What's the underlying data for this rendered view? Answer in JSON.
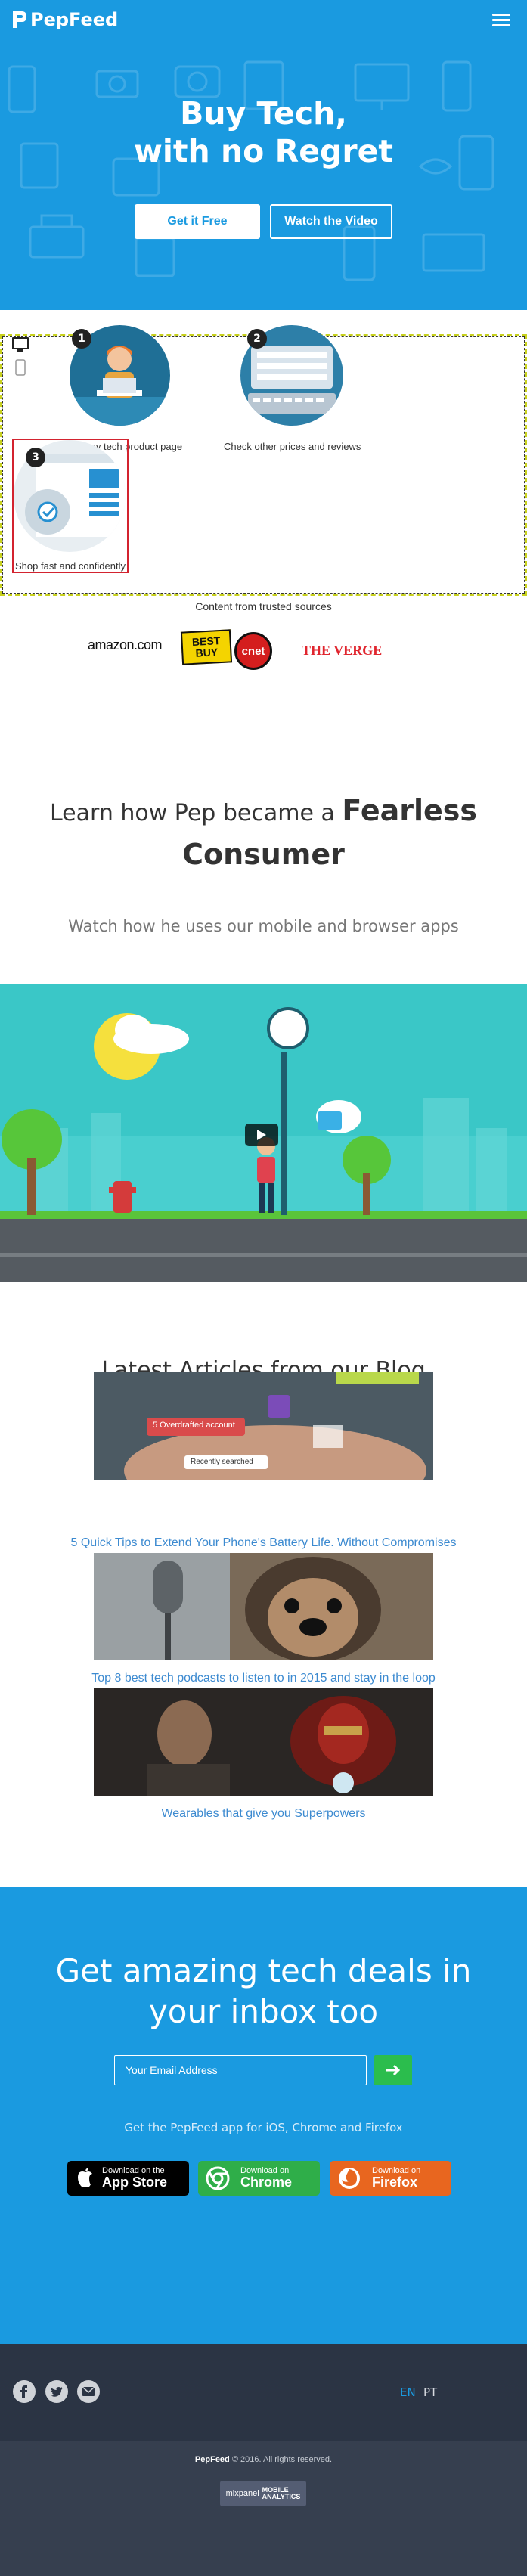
{
  "header": {
    "logo_text": "PepFeed"
  },
  "hero": {
    "title_line1": "Buy Tech,",
    "title_line2": "with no Regret",
    "btn_free": "Get it Free",
    "btn_video": "Watch the Video"
  },
  "steps": [
    {
      "num": "1",
      "label": "Open any tech product page"
    },
    {
      "num": "2",
      "label": "Check other prices and reviews"
    },
    {
      "num": "3",
      "label": "Shop fast and confidently"
    }
  ],
  "trusted": {
    "label": "Content from trusted sources",
    "amazon": "amazon.com",
    "bestbuy_line1": "BEST",
    "bestbuy_line2": "BUY",
    "cnet": "cnet",
    "verge": "THE VERGE"
  },
  "learn": {
    "title_part1": "Learn how Pep became a",
    "title_bold1": "Fearless",
    "title_bold2": "Consumer",
    "subtitle": "Watch how he uses our mobile and browser apps"
  },
  "blog": {
    "title": "Latest Articles from our Blog",
    "articles": [
      {
        "title": "5 Quick Tips to Extend Your Phone's Battery Life. Without Compromises",
        "overlay1": "5 Overdrafted account",
        "overlay2": "Recently searched"
      },
      {
        "title": "Top 8 best tech podcasts to listen to in 2015 and stay in the loop"
      },
      {
        "title": "Wearables that give you Superpowers"
      }
    ]
  },
  "newsletter": {
    "title_line1": "Get amazing tech deals in",
    "title_line2": "your inbox too",
    "email_placeholder": "Your Email Address",
    "get_app": "Get the PepFeed app for iOS, Chrome and Firefox",
    "stores": [
      {
        "small": "Download on the",
        "big": "App Store",
        "color": "#000000"
      },
      {
        "small": "Download on",
        "big": "Chrome",
        "color": "#2fae49"
      },
      {
        "small": "Download on",
        "big": "Firefox",
        "color": "#e8661f"
      }
    ]
  },
  "footer": {
    "lang_en": "EN",
    "lang_pt": "PT",
    "brand": "PepFeed",
    "copyright": "© 2016. All rights reserved.",
    "mixpanel_line1": "mixpanel",
    "mixpanel_line2": "MOBILE",
    "mixpanel_line3": "ANALYTICS",
    "colors": {
      "accent": "#1a9ae0",
      "lang_active": "#1a9ae0",
      "lang_inactive": "#d8dbe0"
    }
  }
}
